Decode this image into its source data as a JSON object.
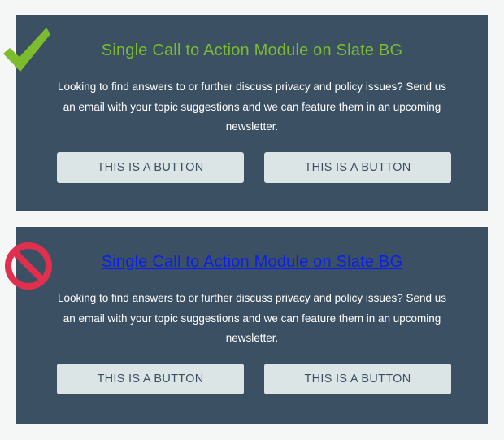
{
  "good_example": {
    "heading": "Single Call to Action Module on Slate BG",
    "body": "Looking to find answers to or further discuss privacy and policy issues? Send us an email with your topic suggestions and we can feature them in an upcoming newsletter.",
    "button_left_label": "THIS IS A BUTTON",
    "button_right_label": "THIS IS A BUTTON",
    "indicator_icon": "checkmark-icon",
    "indicator_color": "#7cbc2d"
  },
  "bad_example": {
    "heading": "Single Call to Action Module on Slate BG",
    "body": "Looking to find answers to or further discuss privacy and policy issues? Send us an email with your topic suggestions and we can feature them in an upcoming newsletter.",
    "button_left_label": "THIS IS A BUTTON",
    "button_right_label": "THIS IS A BUTTON",
    "indicator_icon": "prohibited-icon",
    "indicator_color": "#e0304e"
  },
  "colors": {
    "page_background": "#f5f7f7",
    "module_background": "#3b5063",
    "heading_green": "#7cbc2d",
    "link_blue": "#0a1ff0",
    "button_background": "#dce5e5",
    "button_text": "#3b5063"
  }
}
